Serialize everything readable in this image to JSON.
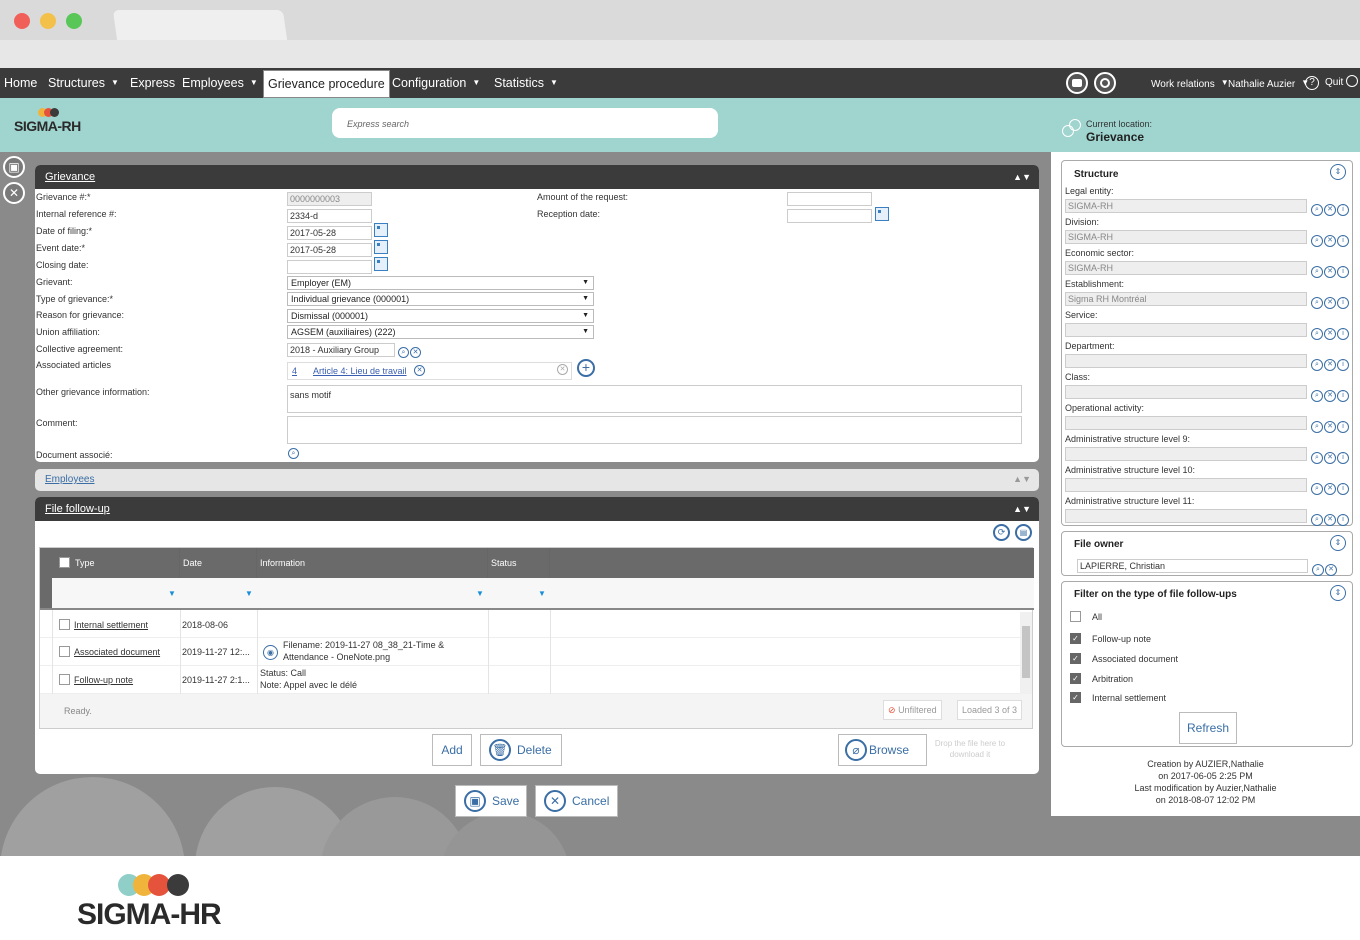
{
  "menu": {
    "items": [
      {
        "label": "Home",
        "dd": false
      },
      {
        "label": "Structures",
        "dd": true
      },
      {
        "label": "Express",
        "dd": false
      },
      {
        "label": "Employees",
        "dd": true
      },
      {
        "label": "Grievance procedure",
        "dd": false
      },
      {
        "label": "Configuration",
        "dd": true
      },
      {
        "label": "Statistics",
        "dd": true
      }
    ],
    "work_relations": "Work relations",
    "user": "Nathalie Auzier",
    "help": "?",
    "quit": "Quit"
  },
  "header": {
    "logo": "SIGMA-RH",
    "search_placeholder": "Express search",
    "location_label": "Current location:",
    "location_value": "Grievance"
  },
  "grievance": {
    "title": "Grievance",
    "labels": {
      "num": "Grievance #:*",
      "ref": "Internal reference #:",
      "filing": "Date of filing:*",
      "event": "Event date:*",
      "closing": "Closing date:",
      "grievant": "Grievant:",
      "type": "Type of grievance:*",
      "reason": "Reason for grievance:",
      "union": "Union affiliation:",
      "agreement": "Collective agreement:",
      "articles": "Associated articles",
      "other": "Other grievance information:",
      "comment": "Comment:",
      "doc": "Document associé:",
      "amount": "Amount of the request:",
      "reception": "Reception date:"
    },
    "values": {
      "num": "0000000003",
      "ref": "2334-d",
      "filing": "2017-05-28",
      "event": "2017-05-28",
      "closing": "",
      "grievant": "Employer (EM)",
      "type": "Individual grievance (000001)",
      "reason": "Dismissal (000001)",
      "union": "AGSEM (auxiliaires) (222)",
      "agreement": "2018 - Auxiliary Group",
      "article_num": "4",
      "article_label": "Article 4: Lieu de travail",
      "other": "sans motif",
      "comment": "",
      "amount": "",
      "reception": ""
    }
  },
  "employees": {
    "title": "Employees"
  },
  "followup": {
    "title": "File follow-up",
    "columns": [
      "Type",
      "Date",
      "Information",
      "Status"
    ],
    "rows": [
      {
        "type": "Internal settlement",
        "date": "2018-08-06",
        "info1": "",
        "info2": ""
      },
      {
        "type": "Associated document",
        "date": "2019-11-27 12:...",
        "info1": "Filename: 2019-11-27 08_38_21-Time &",
        "info2": "Attendance - OneNote.png"
      },
      {
        "type": "Follow-up note",
        "date": "2019-11-27 2:1...",
        "info1": "Status: Call",
        "info2": "Note: Appel avec le délé"
      }
    ],
    "status": "Ready.",
    "unfiltered": "Unfiltered",
    "loaded": "Loaded 3 of 3",
    "add": "Add",
    "delete": "Delete",
    "browse": "Browse",
    "drop": "Drop the file here to download it"
  },
  "actions": {
    "save": "Save",
    "cancel": "Cancel"
  },
  "structure": {
    "title": "Structure",
    "fields": [
      {
        "label": "Legal entity:",
        "value": "SIGMA-RH"
      },
      {
        "label": "Division:",
        "value": "SIGMA-RH"
      },
      {
        "label": "Economic sector:",
        "value": "SIGMA-RH"
      },
      {
        "label": "Establishment:",
        "value": "Sigma RH Montréal"
      },
      {
        "label": "Service:",
        "value": ""
      },
      {
        "label": "Department:",
        "value": ""
      },
      {
        "label": "Class:",
        "value": ""
      },
      {
        "label": "Operational activity:",
        "value": ""
      },
      {
        "label": "Administrative structure level 9:",
        "value": ""
      },
      {
        "label": "Administrative structure level 10:",
        "value": ""
      },
      {
        "label": "Administrative structure level 11:",
        "value": ""
      }
    ]
  },
  "owner": {
    "title": "File owner",
    "value": "LAPIERRE, Christian"
  },
  "filter": {
    "title": "Filter on the type of file follow-ups",
    "items": [
      {
        "label": "All",
        "checked": false
      },
      {
        "label": "Follow-up note",
        "checked": true
      },
      {
        "label": "Associated document",
        "checked": true
      },
      {
        "label": "Arbitration",
        "checked": true
      },
      {
        "label": "Internal settlement",
        "checked": true
      }
    ],
    "refresh": "Refresh"
  },
  "audit": {
    "line1": "Creation by AUZIER,Nathalie",
    "line2": "on 2017-06-05 2:25 PM",
    "line3": "Last modification by Auzier,Nathalie",
    "line4": "on 2018-08-07 12:02 PM"
  },
  "footer_logo": "SIGMA-HR",
  "colors": {
    "menubar": "#3b3b3b",
    "header": "#9fd4cf",
    "accent": "#3a6ea5",
    "footer_dots": [
      "#8fcfc8",
      "#f0b43c",
      "#e6533c",
      "#3b3b3b"
    ]
  }
}
